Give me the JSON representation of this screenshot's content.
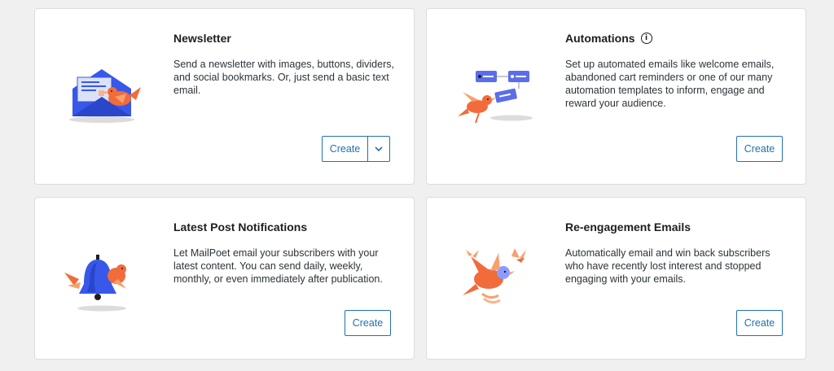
{
  "cards": [
    {
      "title": "Newsletter",
      "description": "Send a newsletter with images, buttons, dividers, and social bookmarks. Or, just send a basic text email.",
      "create_label": "Create",
      "has_dropdown": true,
      "illustration": "envelope-bird-illustration"
    },
    {
      "title": "Automations",
      "title_icon": "info-icon",
      "info_glyph": "i",
      "description": "Set up automated emails like welcome emails, abandoned cart reminders or one of our many automation templates to inform, engage and reward your audience.",
      "create_label": "Create",
      "illustration": "automation-flow-bird-illustration"
    },
    {
      "title": "Latest Post Notifications",
      "description": "Let MailPoet email your subscribers with your latest content. You can send daily, weekly, monthly, or even immediately after publication.",
      "create_label": "Create",
      "illustration": "bell-bird-illustration"
    },
    {
      "title": "Re-engagement Emails",
      "description": "Automatically email and win back subscribers who have recently lost interest and stopped engaging with your emails.",
      "create_label": "Create",
      "illustration": "flying-birds-illustration"
    }
  ],
  "colors": {
    "accent": "#2271b1",
    "bird_orange": "#f26b3a",
    "illustration_blue": "#3858e9",
    "card_border": "#dcdcde",
    "background": "#f0f0f1"
  }
}
